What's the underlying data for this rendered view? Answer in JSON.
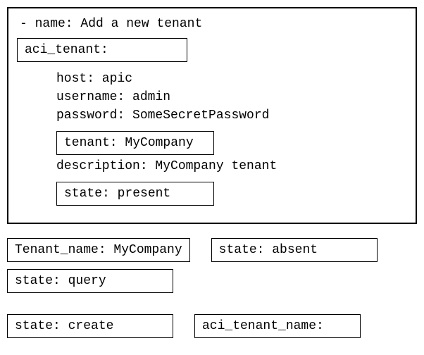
{
  "task": {
    "name_line": "- name: Add a new tenant",
    "module": "aci_tenant:",
    "params": {
      "host": "host: apic",
      "username": "username: admin",
      "password": "password: SomeSecretPassword",
      "tenant": "tenant: MyCompany",
      "description": "description: MyCompany tenant",
      "state": "state: present"
    }
  },
  "options": {
    "tenant_name": "Tenant_name: MyCompany",
    "state_absent": "state: absent",
    "state_query": "state: query",
    "state_create": "state: create",
    "aci_tenant_name": "aci_tenant_name:"
  }
}
